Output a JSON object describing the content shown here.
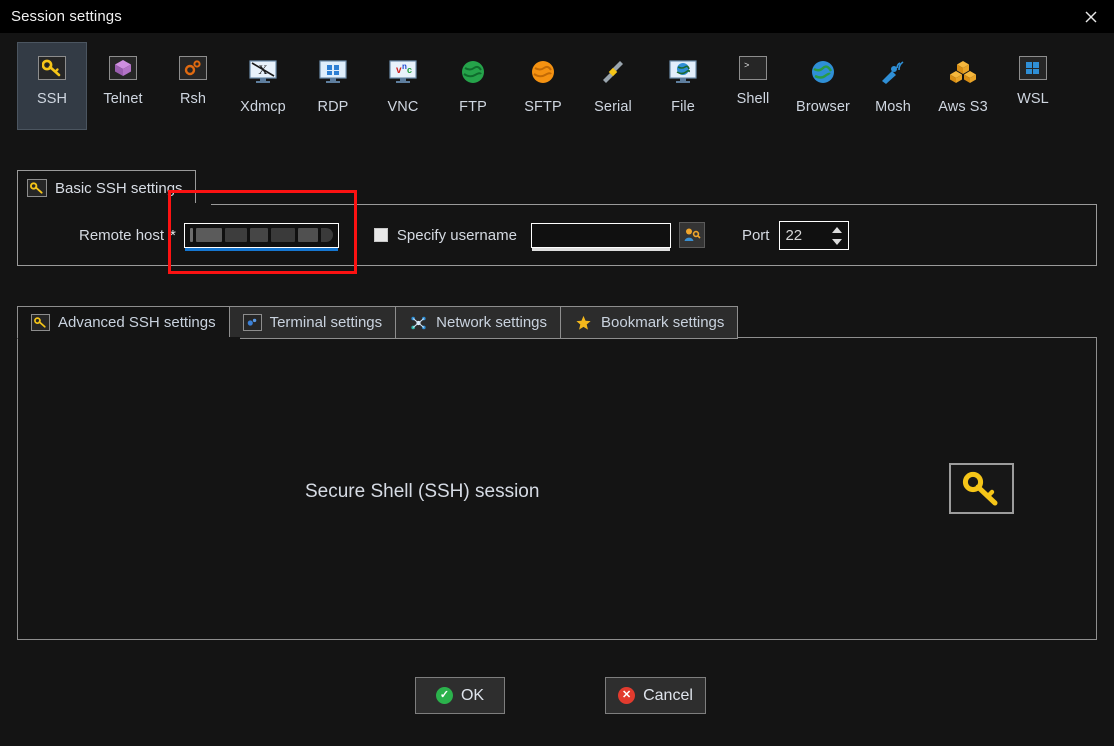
{
  "window": {
    "title": "Session settings",
    "close_label": "×"
  },
  "protocols": [
    {
      "label": "SSH",
      "icon": "key-icon",
      "selected": true
    },
    {
      "label": "Telnet",
      "icon": "cube-icon",
      "selected": false
    },
    {
      "label": "Rsh",
      "icon": "gears-icon",
      "selected": false
    },
    {
      "label": "Xdmcp",
      "icon": "xmonitor-icon",
      "selected": false
    },
    {
      "label": "RDP",
      "icon": "windows-monitor-icon",
      "selected": false
    },
    {
      "label": "VNC",
      "icon": "vnc-monitor-icon",
      "selected": false
    },
    {
      "label": "FTP",
      "icon": "green-globe-icon",
      "selected": false
    },
    {
      "label": "SFTP",
      "icon": "orange-globe-icon",
      "selected": false
    },
    {
      "label": "Serial",
      "icon": "serial-plug-icon",
      "selected": false
    },
    {
      "label": "File",
      "icon": "file-monitor-icon",
      "selected": false
    },
    {
      "label": "Shell",
      "icon": "terminal-icon",
      "selected": false
    },
    {
      "label": "Browser",
      "icon": "blue-globe-icon",
      "selected": false
    },
    {
      "label": "Mosh",
      "icon": "satellite-icon",
      "selected": false
    },
    {
      "label": "Aws S3",
      "icon": "aws-s3-icon",
      "selected": false
    },
    {
      "label": "WSL",
      "icon": "windows-icon",
      "selected": false
    }
  ],
  "basic": {
    "group_label": "Basic SSH settings",
    "group_icon": "key-icon",
    "remote_host_label": "Remote host",
    "remote_host_required": "*",
    "remote_host_value": "",
    "remote_host_redacted": true,
    "specify_username_label": "Specify username",
    "specify_username_checked": false,
    "username_value": "",
    "username_picker_icon": "user-key-icon",
    "port_label": "Port",
    "port_value": "22"
  },
  "annotation": {
    "color": "#fc1212",
    "target": "remote-host-input"
  },
  "tabs": [
    {
      "label": "Advanced SSH settings",
      "icon": "key-icon",
      "active": true
    },
    {
      "label": "Terminal settings",
      "icon": "terminal-gear-icon",
      "active": false
    },
    {
      "label": "Network settings",
      "icon": "network-icon",
      "active": false
    },
    {
      "label": "Bookmark settings",
      "icon": "star-icon",
      "active": false
    }
  ],
  "panel": {
    "caption": "Secure Shell (SSH) session",
    "icon": "key-icon"
  },
  "footer": {
    "ok_label": "OK",
    "ok_icon": "check-circle-icon",
    "cancel_label": "Cancel",
    "cancel_icon": "x-circle-icon"
  },
  "colors": {
    "window_bg": "#141414",
    "titlebar_bg": "#000000",
    "selected_tab_bg": "#333b45",
    "focus_underline": "#1576d0",
    "annotation": "#fc1212",
    "ok_badge": "#2bb24c",
    "cancel_badge": "#e23b2e"
  }
}
